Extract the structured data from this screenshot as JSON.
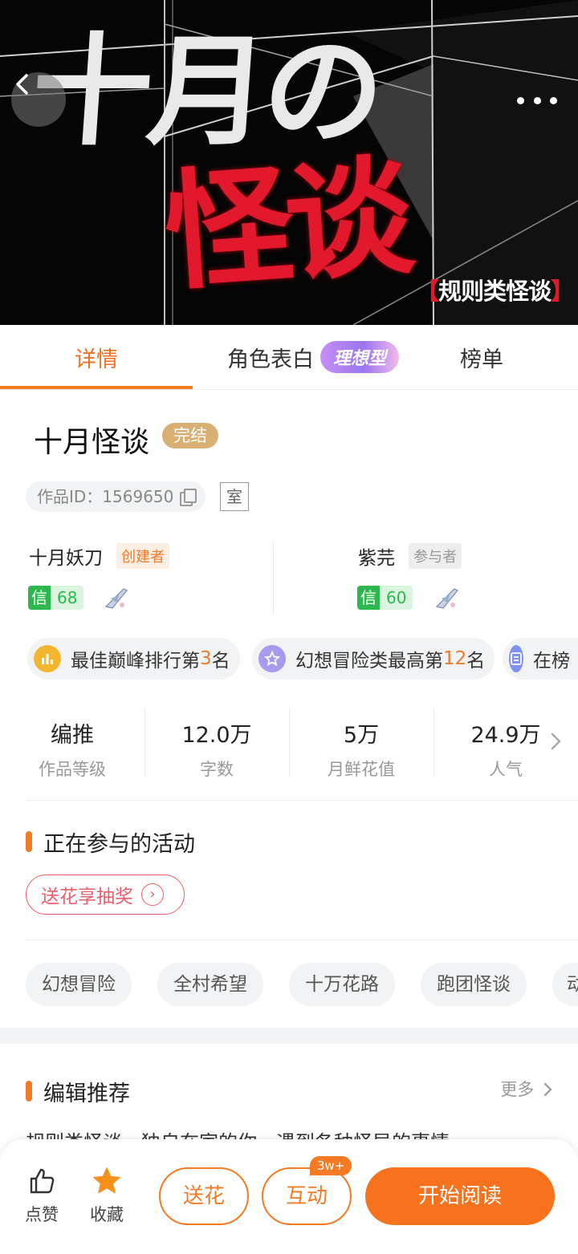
{
  "cover": {
    "title_line1": "十月の",
    "title_line2": "怪谈",
    "tag_text": "规则类怪谈",
    "tag_bracket_open": "【",
    "tag_bracket_close": "】",
    "back_icon": "chevron-left-icon",
    "more_icon": "more-horizontal-icon"
  },
  "tabs": [
    {
      "label": "详情",
      "active": true
    },
    {
      "label": "角色表白",
      "badge": "理想型"
    },
    {
      "label": "榜单"
    }
  ],
  "book": {
    "title": "十月怪谈",
    "status": "完结",
    "work_id": "作品ID：1569650",
    "room_label": "室"
  },
  "authors": [
    {
      "name": "十月妖刀",
      "role": "创建者",
      "trust_label": "信",
      "trust_value": "68"
    },
    {
      "name": "紫芫",
      "role": "参与者",
      "trust_label": "信",
      "trust_value": "60"
    }
  ],
  "rank_chips": [
    {
      "prefix": "最佳巅峰排行第",
      "number": "3",
      "suffix": "名",
      "icon": "bar-chart-icon",
      "color": "#f5b62f"
    },
    {
      "prefix": "幻想冒险类最高第",
      "number": "12",
      "suffix": "名",
      "icon": "star-badge-icon",
      "color": "#a89bef"
    },
    {
      "prefix": "在榜",
      "number": "",
      "suffix": "",
      "icon": "list-doc-icon",
      "color": "#7f92f0"
    }
  ],
  "stats": [
    {
      "value": "编推",
      "label": "作品等级"
    },
    {
      "value": "12.0万",
      "label": "字数"
    },
    {
      "value": "5万",
      "label": "月鲜花值"
    },
    {
      "value": "24.9万",
      "label": "人气"
    }
  ],
  "activities": {
    "title": "正在参与的活动",
    "button": "送花享抽奖"
  },
  "tags": [
    "幻想冒险",
    "全村希望",
    "十万花路",
    "跑团怪谈",
    "动"
  ],
  "editor": {
    "title": "编辑推荐",
    "more": "更多",
    "text": "规则类怪谈，独自在家的你，遇到各种怪异的事情"
  },
  "bottom_bar": {
    "like": "点赞",
    "favorite": "收藏",
    "flower": "送花",
    "interact": "互动",
    "interact_badge": "3w+",
    "read": "开始阅读"
  },
  "colors": {
    "accent": "#f47a24",
    "trust_green": "#2db84f",
    "status_gold": "#d9b074",
    "activity_red": "#ef5d6a",
    "cover_red": "#e2182c"
  }
}
